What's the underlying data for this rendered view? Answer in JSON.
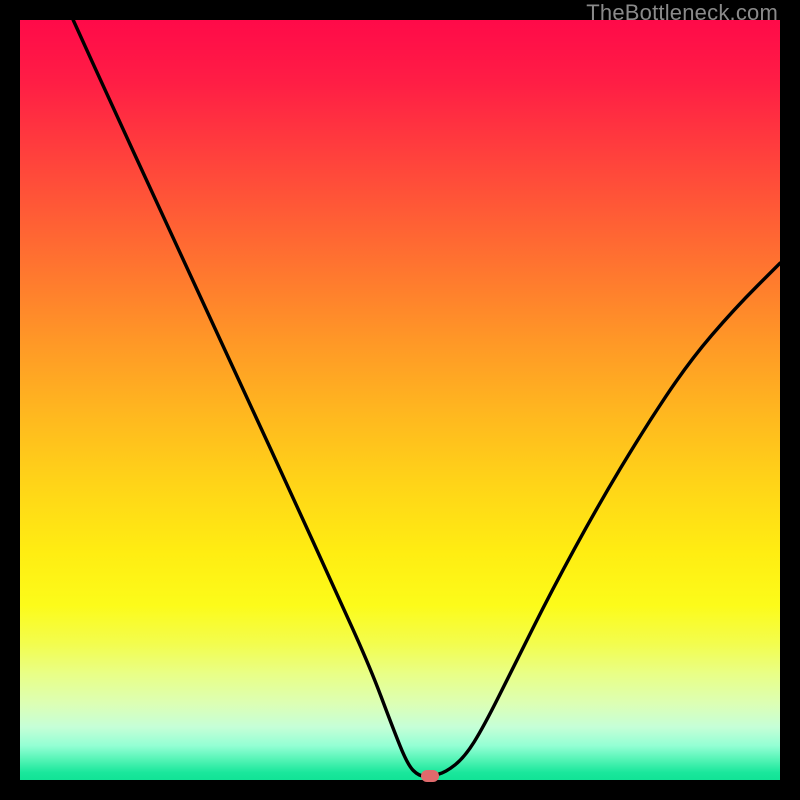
{
  "watermark": "TheBottleneck.com",
  "chart_data": {
    "type": "line",
    "title": "",
    "xlabel": "",
    "ylabel": "",
    "xlim": [
      0,
      100
    ],
    "ylim": [
      0,
      100
    ],
    "grid": false,
    "legend": false,
    "series": [
      {
        "name": "curve",
        "x": [
          7,
          12,
          18,
          24,
          30,
          36,
          41,
          46,
          49,
          51,
          52.5,
          54,
          56,
          58.5,
          61,
          65,
          70,
          76,
          82,
          88,
          94,
          100
        ],
        "y": [
          100,
          89,
          76,
          63,
          50,
          37,
          26,
          15,
          7,
          2,
          0.5,
          0.5,
          1,
          3,
          7,
          15,
          25,
          36,
          46,
          55,
          62,
          68
        ]
      }
    ],
    "marker": {
      "x": 54,
      "y": 0.5,
      "color": "#e06a6c"
    }
  }
}
